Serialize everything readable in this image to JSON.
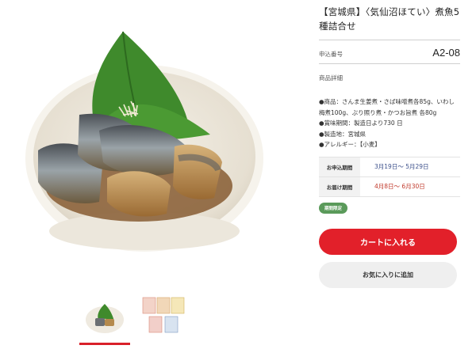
{
  "product": {
    "title": "【宮城県】〈気仙沼ほてい〉煮魚5種詰合せ",
    "application_label": "申込番号",
    "application_number": "A2-08",
    "details_title": "商品詳細",
    "details": [
      "●商品：さんま生姜煮・さば味噌煮各85g、いわし梅煮100g、ぶり照り煮・かつお旨煮 各80g",
      "●賞味期間：製造日より730 日",
      "●製造地：宮城県",
      "●アレルギー：【小麦】"
    ],
    "periods": [
      {
        "label": "お申込期間",
        "value": "3月19日～ 5月29日"
      },
      {
        "label": "お届け期間",
        "value": "4月8日～ 6月30日"
      }
    ],
    "badge": "期間限定",
    "cart_button": "カートに入れる",
    "favorite_button": "お気に入りに追加"
  },
  "colors": {
    "accent_red": "#e2202a",
    "badge_green": "#5a9a5a",
    "apply_period_text": "#3b4f8a",
    "delivery_period_text": "#c0392b"
  }
}
